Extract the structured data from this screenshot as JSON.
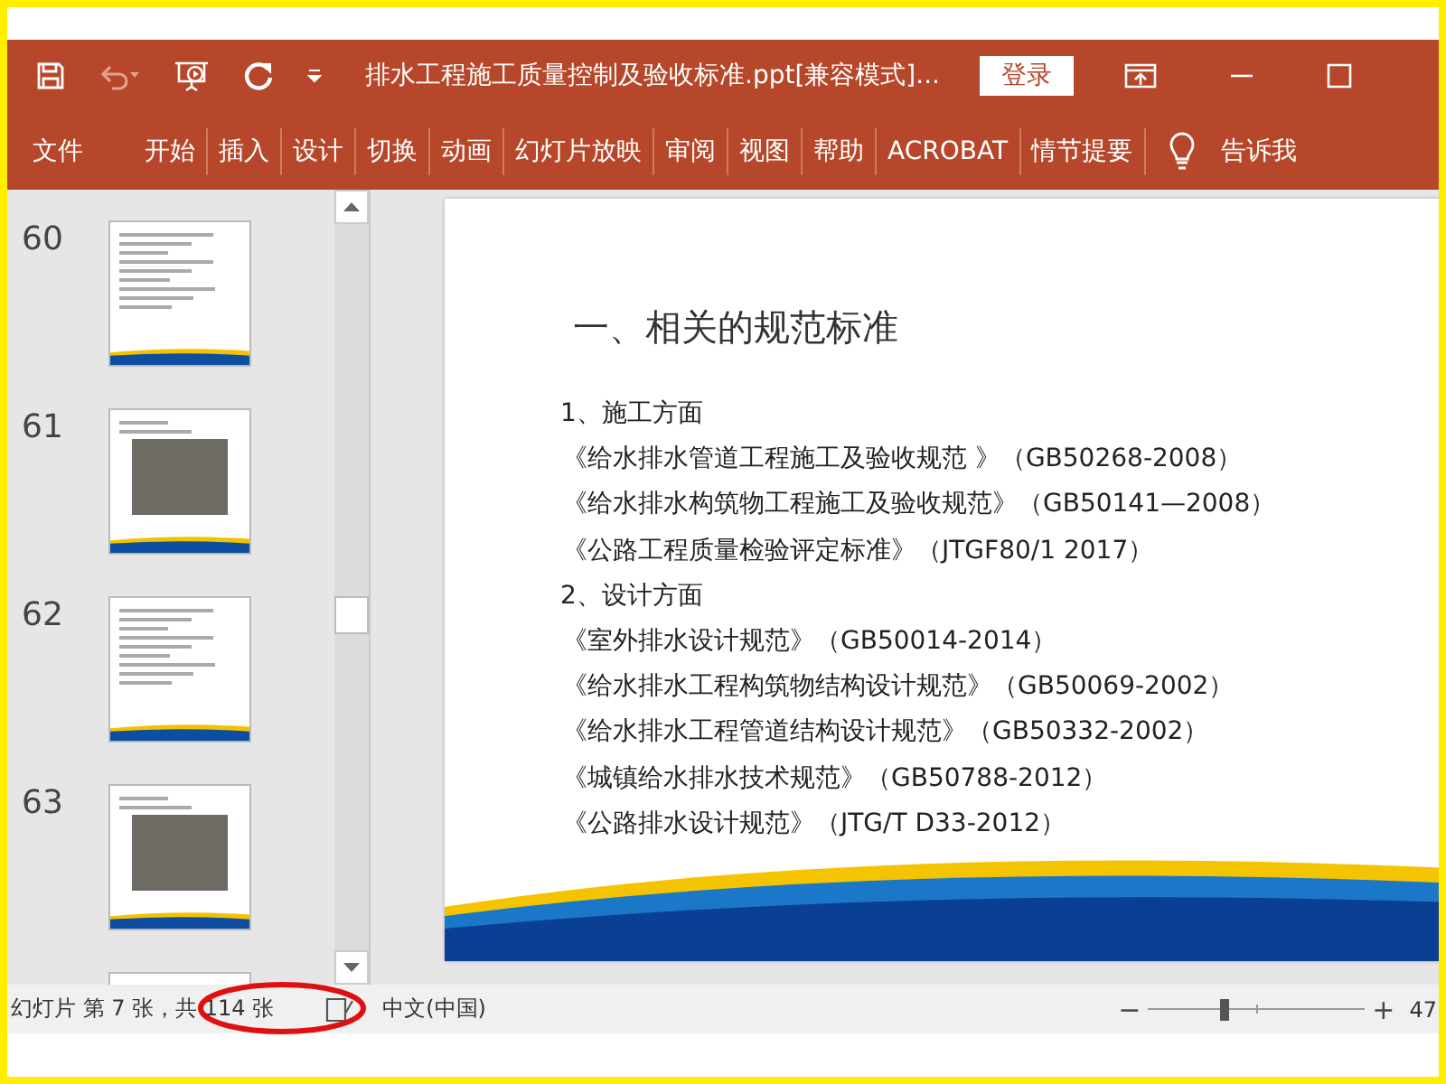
{
  "window": {
    "title": "排水工程施工质量控制及验收标准.ppt[兼容模式]...",
    "login_button": "登录"
  },
  "ribbon": {
    "tabs": [
      {
        "label": "文件"
      },
      {
        "label": "开始"
      },
      {
        "label": "插入"
      },
      {
        "label": "设计"
      },
      {
        "label": "切换"
      },
      {
        "label": "动画"
      },
      {
        "label": "幻灯片放映"
      },
      {
        "label": "审阅"
      },
      {
        "label": "视图"
      },
      {
        "label": "帮助"
      },
      {
        "label": "ACROBAT"
      },
      {
        "label": "情节提要"
      }
    ],
    "tell_me": "告诉我"
  },
  "thumbnails": [
    {
      "number": "60",
      "kind": "text"
    },
    {
      "number": "61",
      "kind": "photo"
    },
    {
      "number": "62",
      "kind": "text"
    },
    {
      "number": "63",
      "kind": "photo"
    }
  ],
  "slide": {
    "title": "一、相关的规范标准",
    "lines": [
      {
        "kind": "heading",
        "text": "1、施工方面"
      },
      {
        "kind": "item",
        "text": "《给水排水管道工程施工及验收规范 》（GB50268-2008）"
      },
      {
        "kind": "item",
        "text": "《给水排水构筑物工程施工及验收规范》（GB50141—2008）"
      },
      {
        "kind": "item",
        "text": "《公路工程质量检验评定标准》（JTGF80/1  2017）"
      },
      {
        "kind": "heading",
        "text": "2、设计方面"
      },
      {
        "kind": "item",
        "text": "《室外排水设计规范》（GB50014-2014）"
      },
      {
        "kind": "item",
        "text": "《给水排水工程构筑物结构设计规范》（GB50069-2002）"
      },
      {
        "kind": "item",
        "text": "《给水排水工程管道结构设计规范》（GB50332-2002）"
      },
      {
        "kind": "item",
        "text": "《城镇给水排水技术规范》（GB50788-2012）"
      },
      {
        "kind": "item",
        "text": "《公路排水设计规范》（JTG/T  D33-2012）"
      }
    ]
  },
  "status_bar": {
    "slide_count": "幻灯片 第 7 张，共 114 张",
    "language": "中文(中国)",
    "zoom_out": "−",
    "zoom_in": "+",
    "zoom": {
      "level": 0.33
    },
    "zoom_percent": "47"
  }
}
